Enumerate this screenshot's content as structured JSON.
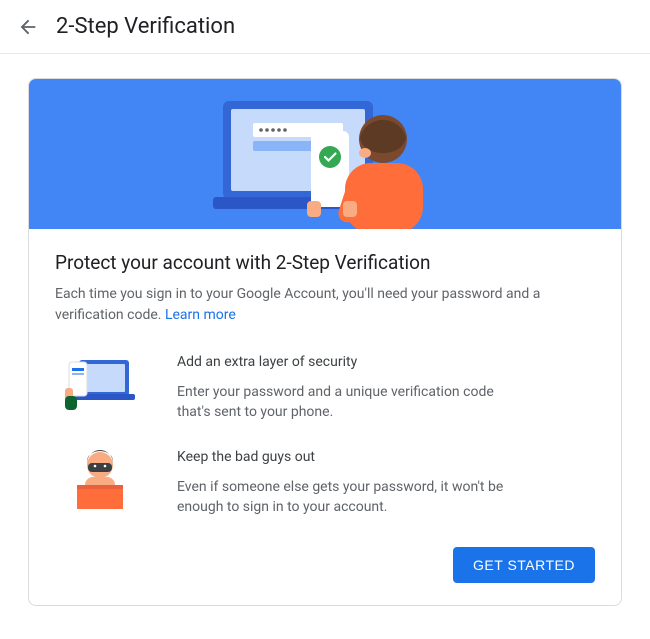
{
  "header": {
    "title": "2-Step Verification"
  },
  "main": {
    "title": "Protect your account with 2-Step Verification",
    "description": "Each time you sign in to your Google Account, you'll need your password and a verification code. ",
    "learn_more": "Learn more",
    "features": [
      {
        "title": "Add an extra layer of security",
        "desc": "Enter your password and a unique verification code that's sent to your phone."
      },
      {
        "title": "Keep the bad guys out",
        "desc": "Even if someone else gets your password, it won't be enough to sign in to your account."
      }
    ],
    "cta": "GET STARTED"
  }
}
